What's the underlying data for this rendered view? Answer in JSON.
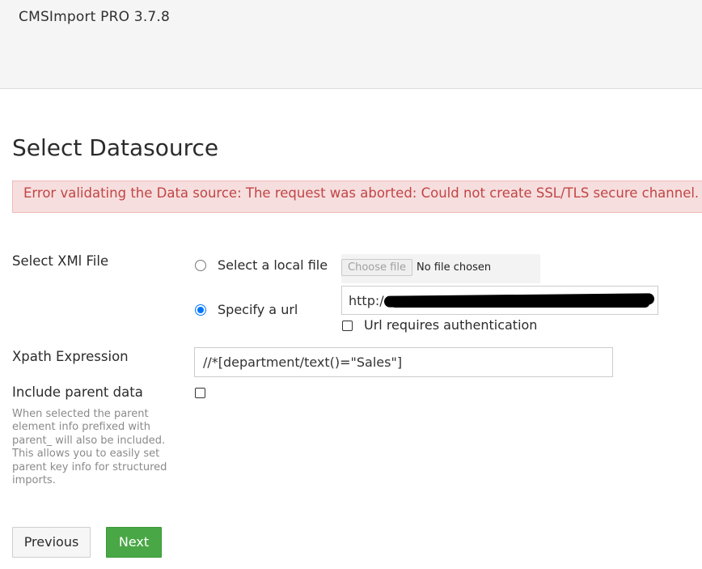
{
  "header": {
    "app_title": "CMSImport PRO 3.7.8"
  },
  "page": {
    "title": "Select Datasource"
  },
  "alert": {
    "message": "Error validating the Data source: The request was aborted: Could not create SSL/TLS secure channel."
  },
  "form": {
    "xml_file_label": "Select XMl File",
    "local_file_option": "Select a local file",
    "local_file_selected": false,
    "file_button_label": "Choose file",
    "file_status": "No file chosen",
    "url_option": "Specify a url",
    "url_option_selected": true,
    "url_value_visible": "http:/",
    "url_auth_label": "Url requires authentication",
    "url_auth_checked": false,
    "xpath_label": "Xpath Expression",
    "xpath_value": "//*[department/text()=\"Sales\"]",
    "parent_label": "Include parent data",
    "parent_checked": false,
    "parent_help": "When selected the parent element info prefixed with parent_ will also be included. This allows you to easily set parent key info for structured imports."
  },
  "buttons": {
    "previous": "Previous",
    "next": "Next"
  },
  "colors": {
    "error_bg": "#f7dede",
    "error_text": "#c14545",
    "accent_radio": "#0075ff",
    "next_button": "#49a745"
  }
}
